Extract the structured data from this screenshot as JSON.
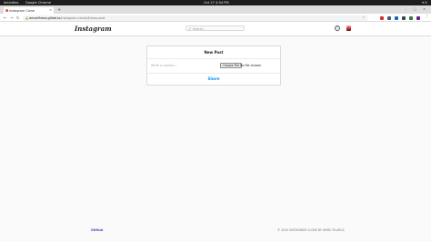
{
  "system_bar": {
    "activities": "Activities",
    "app": "Google Chrome",
    "clock": "Oct 27  4:54 PM",
    "tray": "▾ ⏻"
  },
  "browser": {
    "tab_title": "Instagram Clone",
    "tab_close": "×",
    "new_tab": "+",
    "window_controls": "– ▢ ×",
    "url_host": "amvel9arra.gitlab.io",
    "url_path": "/instagram-clone/#/new-post",
    "extension_colors": [
      "#d32f2f",
      "#455a64",
      "#1565c0",
      "#37474f",
      "#2e7d32",
      "#6a1b9a"
    ]
  },
  "header": {
    "logo": "Instagram",
    "search_placeholder": "Search"
  },
  "new_post": {
    "title": "New Post",
    "caption_placeholder": "Write a caption...",
    "choose_file_label": "Choose File",
    "file_status": "No file chosen",
    "share_label": "Share"
  },
  "footer": {
    "left_link": "GitHub",
    "copyright": "© 2020 INSTAGRAM CLONE BY AMIEL FILARCA"
  }
}
